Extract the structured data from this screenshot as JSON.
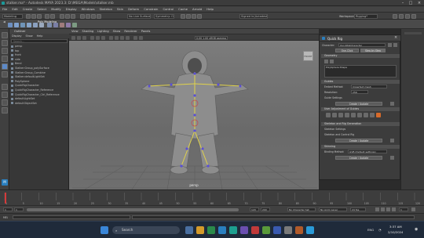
{
  "window": {
    "title": "stalker.ma* - Autodesk MAYA 2023.3: D:\\MEGA\\Models\\stalker.mb"
  },
  "menubar": {
    "items": [
      "File",
      "Edit",
      "Create",
      "Select",
      "Modify",
      "Display",
      "Windows",
      "Skeleton",
      "Skin",
      "Deform",
      "Constrain",
      "Control",
      "Cache",
      "Arnold",
      "Help"
    ]
  },
  "statusline": {
    "menuset": "Modeling",
    "no_live": "No Live Surface",
    "symmetry": "Symmetry: Off",
    "workspace_label": "Workspace:",
    "workspace_value": "Rigging*",
    "user": "Signed In(Autodesk)"
  },
  "shelf": {
    "tab": "Poly Modeling"
  },
  "outliner": {
    "title": "Outliner",
    "menu": [
      "Display",
      "Show",
      "Help"
    ],
    "search_placeholder": "Search...",
    "items": [
      "persp",
      "top",
      "front",
      "side",
      "Bend",
      "Stalker:Group_polySurface",
      "Stalker:Group_Combine",
      "Stalker:defaultLightSet",
      "PolySphere",
      "QuickRigCharacter",
      "QuickRigCharacter_Reference",
      "QuickRigCharacter_Ctrl_Reference",
      "defaultLightSet",
      "defaultObjectSet"
    ]
  },
  "viewport": {
    "menu": [
      "View",
      "Shading",
      "Lighting",
      "Show",
      "Renderer",
      "Panels"
    ],
    "camera": "persp",
    "resolution": "0.00   1.00   sRGB gamma",
    "cube": "FRONT"
  },
  "quickrig": {
    "title": "Quick Rig",
    "character_label": "Character:",
    "character_value": "QuickRigCharacter",
    "mode_step": "Step-by-Step",
    "mode_oneclick": "One-Click",
    "geometry_section": "Geometry",
    "geometry_list": "PolySphere:Shape",
    "guides_section": "Guides",
    "embed_label": "Embed Method:",
    "embed_value": "Imperfect mesh",
    "resolution_label": "Resolution:",
    "resolution_value": "256",
    "guide_settings": "Guide Settings",
    "create_update": "Create / Update",
    "user_adjust": "User Adjustment of Guides",
    "skeleton_section": "Skeleton and Rig Generation",
    "skeleton_settings": "Skeleton Settings",
    "skeleton_rig_label": "Skeleton and Control Rig",
    "skinning_section": "Skinning",
    "bind_label": "Binding Method:",
    "bind_value": "GVB (Default settings)"
  },
  "timeline": {
    "ticks": [
      "1",
      "5",
      "10",
      "15",
      "20",
      "25",
      "30",
      "35",
      "40",
      "45",
      "50",
      "55",
      "60",
      "65",
      "70",
      "75",
      "80",
      "85",
      "90",
      "95",
      "100",
      "105",
      "110",
      "115",
      "120"
    ],
    "start": "1",
    "end": "120",
    "range_start": "1",
    "range_end": "120",
    "anim_end": "200",
    "current": "1",
    "no_char": "No Character Set",
    "anim_layer": "No Anim Layer",
    "fps": "24 fps"
  },
  "cmdline": {
    "label": "MEL"
  },
  "taskbar": {
    "search": "Search",
    "time": "3:37 AM",
    "date": "2/10/2024",
    "lang": "ENG"
  }
}
